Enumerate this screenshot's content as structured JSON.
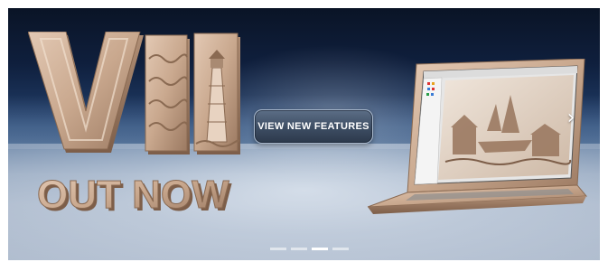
{
  "hero": {
    "headline": "VII",
    "tagline": "OUT NOW",
    "cta_label": "VIEW NEW FEATURES",
    "next_icon": "chevron-right-icon"
  },
  "carousel": {
    "slide_count": 4,
    "active_index": 2
  },
  "colors": {
    "wood": "#c9a88e",
    "button": "#3d4d63",
    "sky_top": "#0a1426",
    "floor": "#c9d2df"
  }
}
